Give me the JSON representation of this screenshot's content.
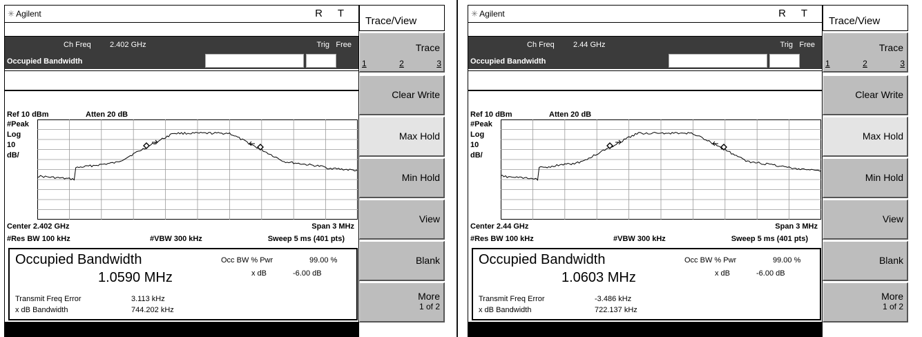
{
  "panels": [
    {
      "brand": "Agilent",
      "rt": "R T",
      "ch_freq_label": "Ch Freq",
      "ch_freq_value": "2.402 GHz",
      "trig_label": "Trig",
      "trig_value": "Free",
      "measurement": "Occupied Bandwidth",
      "ref": "Ref 10 dBm",
      "atten": "Atten 20 dB",
      "peak": "#Peak",
      "log": "Log",
      "scale_num": "10",
      "scale_unit": "dB/",
      "center": "Center 2.402 GHz",
      "span": "Span 3 MHz",
      "res_bw": "#Res BW 100 kHz",
      "vbw": "#VBW 300 kHz",
      "sweep": "Sweep 5 ms (401 pts)",
      "result_title": "Occupied Bandwidth",
      "result_value": "1.0590 MHz",
      "occ_label": "Occ BW % Pwr",
      "occ_value": "99.00 %",
      "xdb_label": "x dB",
      "xdb_value": "-6.00 dB",
      "tfe_label": "Transmit Freq Error",
      "tfe_value": "3.113 kHz",
      "xbw_label": "x dB Bandwidth",
      "xbw_value": "744.202 kHz"
    },
    {
      "brand": "Agilent",
      "rt": "R T",
      "ch_freq_label": "Ch Freq",
      "ch_freq_value": "2.44 GHz",
      "trig_label": "Trig",
      "trig_value": "Free",
      "measurement": "Occupied Bandwidth",
      "ref": "Ref 10 dBm",
      "atten": "Atten 20 dB",
      "peak": "#Peak",
      "log": "Log",
      "scale_num": "10",
      "scale_unit": "dB/",
      "center": "Center 2.44 GHz",
      "span": "Span 3 MHz",
      "res_bw": "#Res BW 100 kHz",
      "vbw": "#VBW 300 kHz",
      "sweep": "Sweep 5 ms (401 pts)",
      "result_title": "Occupied Bandwidth",
      "result_value": "1.0603 MHz",
      "occ_label": "Occ BW % Pwr",
      "occ_value": "99.00 %",
      "xdb_label": "x dB",
      "xdb_value": "-6.00 dB",
      "tfe_label": "Transmit Freq Error",
      "tfe_value": "-3.486 kHz",
      "xbw_label": "x dB Bandwidth",
      "xbw_value": "722.137 kHz"
    }
  ],
  "softkeys": {
    "title": "Trace/View",
    "trace": "Trace",
    "trace_nums": [
      "1",
      "2",
      "3"
    ],
    "clear_write": "Clear Write",
    "max_hold": "Max Hold",
    "min_hold": "Min Hold",
    "view": "View",
    "blank": "Blank",
    "more": "More",
    "more_sub": "1 of 2"
  },
  "colors": {
    "header_bar": "#3b3b3b",
    "softkey": "#bdbdbd",
    "softkey_selected": "#e4e4e4"
  },
  "icons": {
    "brand_logo": "starburst-icon",
    "marker": "diamond-marker-icon"
  }
}
